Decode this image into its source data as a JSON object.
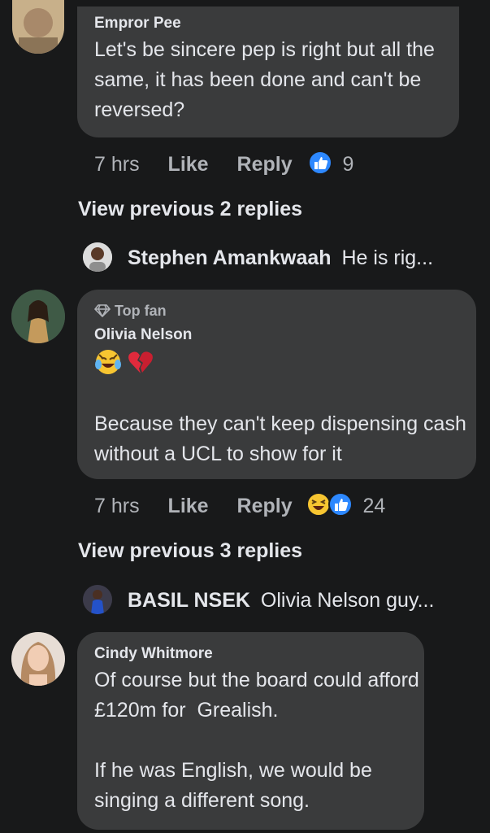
{
  "comments": [
    {
      "author": "Empror Pee",
      "text": "Let's be sincere pep is right but all the same, it has been done and can't be reversed?",
      "time": "7 hrs",
      "like_label": "Like",
      "reply_label": "Reply",
      "reaction_count": "9",
      "reactions": [
        "like-icon"
      ]
    },
    {
      "badge": "Top fan",
      "author": "Olivia Nelson",
      "emojis": [
        "laughing-crying-emoji",
        "broken-heart-emoji"
      ],
      "text": "Because they can't keep dispensing cash without a UCL to show for it",
      "time": "7 hrs",
      "like_label": "Like",
      "reply_label": "Reply",
      "reaction_count": "24",
      "reactions": [
        "haha-icon",
        "like-icon"
      ]
    },
    {
      "author": "Cindy Whitmore",
      "text": "Of course but the board could afford £120m for  Grealish.\n\nIf he was English, we would be singing a different song."
    }
  ],
  "thread1": {
    "view_previous": "View previous 2 replies",
    "reply_author": "Stephen Amankwaah",
    "reply_snippet": "He is rig..."
  },
  "thread2": {
    "view_previous": "View previous 3 replies",
    "reply_author": "BASIL NSEK",
    "reply_snippet": "Olivia Nelson guy..."
  },
  "colors": {
    "background": "#18191a",
    "bubble": "#3a3b3c",
    "text": "#e4e6eb",
    "muted": "#b0b3b8",
    "like_blue": "#2d88ff"
  }
}
